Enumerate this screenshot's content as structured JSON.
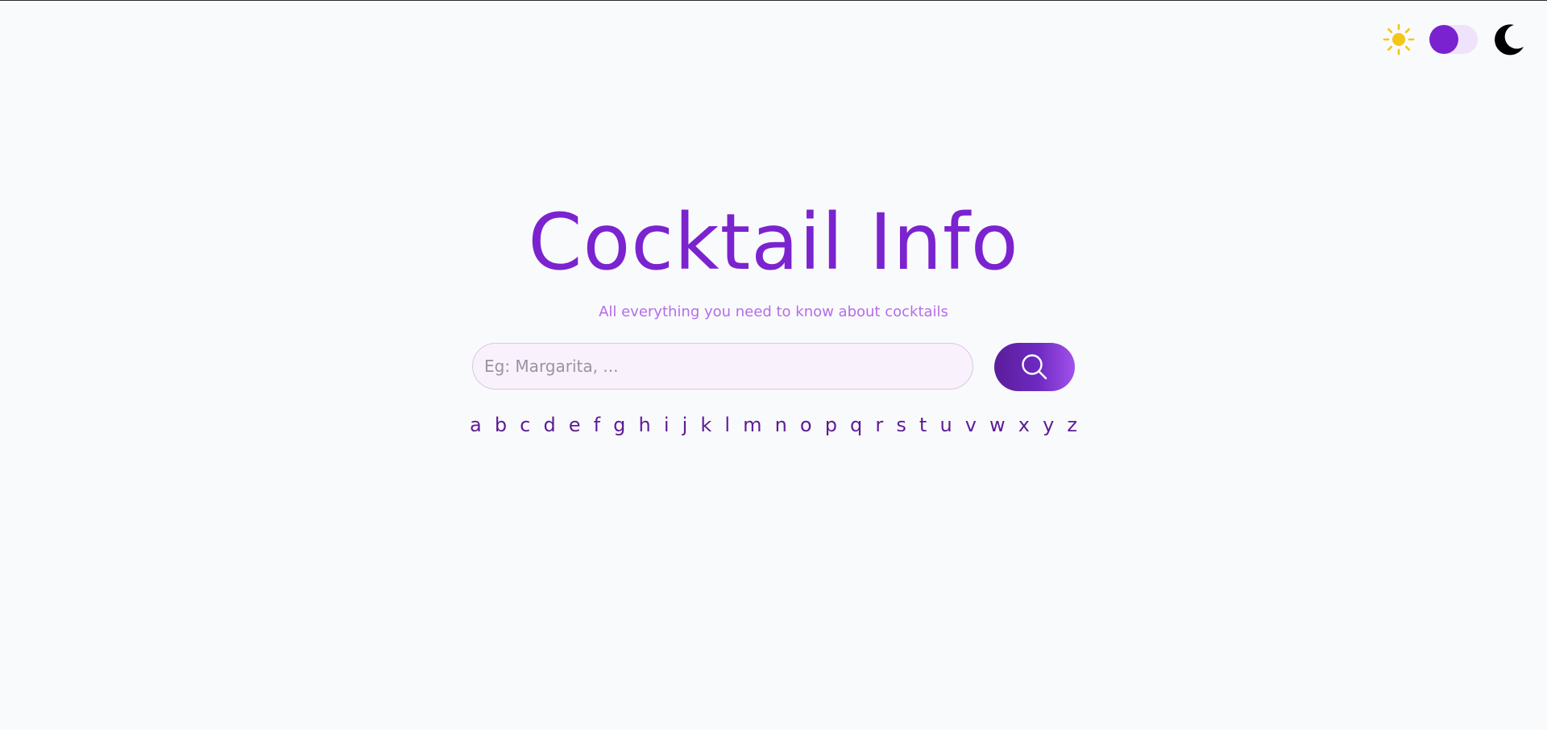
{
  "header": {
    "theme": {
      "light_icon": "sun-icon",
      "dark_icon": "moon-icon",
      "mode": "light"
    }
  },
  "hero": {
    "title": "Cocktail Info",
    "subtitle": "All everything you need to know about cocktails"
  },
  "search": {
    "placeholder": "Eg: Margarita, ...",
    "value": "",
    "button_icon": "search-icon"
  },
  "letters": [
    "a",
    "b",
    "c",
    "d",
    "e",
    "f",
    "g",
    "h",
    "i",
    "j",
    "k",
    "l",
    "m",
    "n",
    "o",
    "p",
    "q",
    "r",
    "s",
    "t",
    "u",
    "v",
    "w",
    "x",
    "y",
    "z"
  ],
  "colors": {
    "accent": "#7b23cf",
    "subtitle": "#b46ee8",
    "letter": "#5e1b95",
    "background": "#f9fafc",
    "sun": "#f5c518"
  }
}
